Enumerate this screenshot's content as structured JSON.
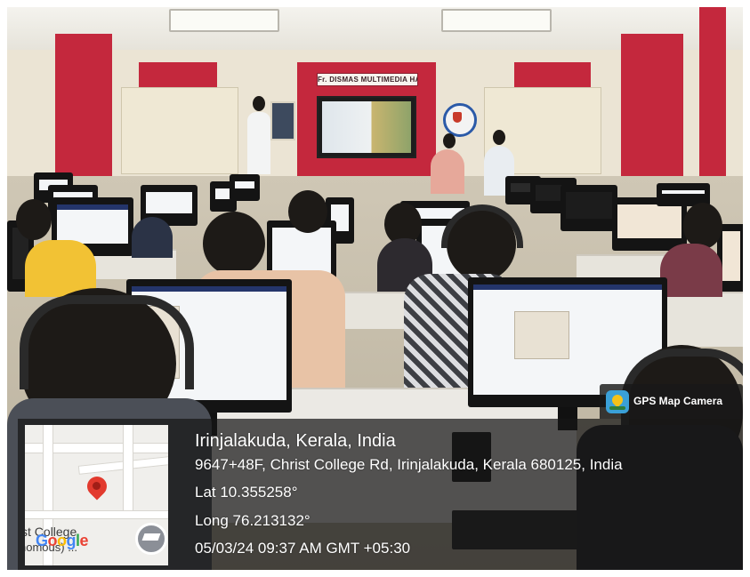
{
  "scene": {
    "hall_sign": "Fr. DISMAS MULTIMEDIA HALL"
  },
  "gps": {
    "app_name": "GPS Map Camera",
    "app_icon": "gps-map-camera-icon",
    "location_title": "Irinjalakuda, Kerala, India",
    "address": "9647+48F, Christ College Rd, Irinjalakuda, Kerala 680125, India",
    "latitude": "Lat 10.355258°",
    "longitude": "Long 76.213132°",
    "datetime": "05/03/24 09:37 AM GMT +05:30",
    "map": {
      "label_line1": "st College",
      "label_line2": "nomous) ...",
      "watermark": "Google",
      "pin_icon": "map-pin-icon",
      "place_icon": "graduation-cap-icon"
    }
  },
  "colors": {
    "wall_red": "#c4283d",
    "overlay": "#161616",
    "pin": "#e23a2e"
  }
}
